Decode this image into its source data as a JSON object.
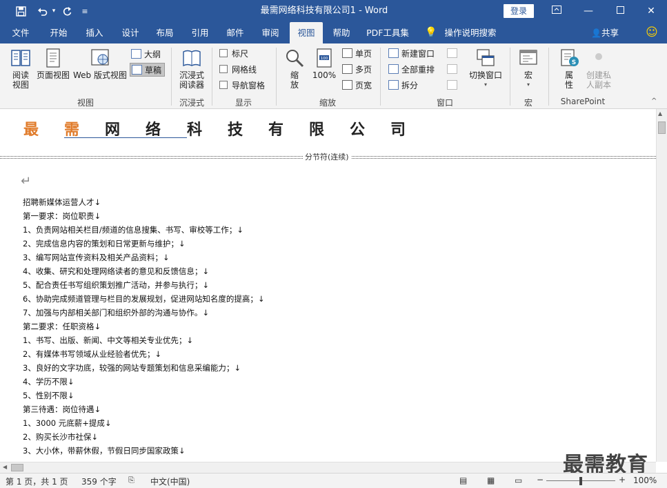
{
  "window": {
    "title": "最需网络科技有限公司1 - Word",
    "login": "登录"
  },
  "tabs": [
    "文件",
    "开始",
    "插入",
    "设计",
    "布局",
    "引用",
    "邮件",
    "审阅",
    "视图",
    "帮助",
    "PDF工具集",
    "操作说明搜索"
  ],
  "active_tab": "视图",
  "share": "共享",
  "ribbon": {
    "views": {
      "label": "视图",
      "read": "阅读\n视图",
      "print": "页面视图",
      "web": "Web 版式视图",
      "outline": "大纲",
      "draft": "草稿"
    },
    "immersive": {
      "label": "沉浸式",
      "reader": "沉浸式\n阅读器"
    },
    "show": {
      "label": "显示",
      "ruler": "标尺",
      "grid": "网格线",
      "nav": "导航窗格"
    },
    "zoom": {
      "label": "缩放",
      "zoom": "缩\n放",
      "hundred": "100%",
      "one": "单页",
      "multi": "多页",
      "width": "页宽"
    },
    "window": {
      "label": "窗口",
      "new": "新建窗口",
      "arrange": "全部重排",
      "split": "拆分",
      "switch": "切换窗口"
    },
    "macro": {
      "label": "宏",
      "macro": "宏"
    },
    "sharepoint": {
      "label": "SharePoint",
      "props": "属\n性",
      "copy": "创建私\n人副本"
    }
  },
  "doc": {
    "heading": [
      "最",
      "需",
      "网",
      "络",
      "科",
      "技",
      "有",
      "限",
      "公",
      "司"
    ],
    "section_break": "分节符(连续)",
    "lines": [
      "招聘新媒体运营人才↓",
      "第一要求：岗位职责↓",
      "1、负责网站相关栏目/频道的信息搜集、书写、审校等工作；↓",
      "2、完成信息内容的策划和日常更新与维护；↓",
      "3、编写网站宣传资料及相关产品资料；↓",
      "4、收集、研究和处理网络读者的意见和反馈信息；↓",
      "5、配合责任书写组织策划推广活动，并参与执行；↓",
      "6、协助完成频道管理与栏目的发展规划，促进网站知名度的提高；↓",
      "7、加强与内部相关部门和组织外部的沟通与协作。↓",
      "第二要求：任职资格↓",
      "1、书写、出版、新闻、中文等相关专业优先；↓",
      "2、有媒体书写领域从业经验者优先；↓",
      "3、良好的文字功底，较强的网站专题策划和信息采编能力；↓",
      "4、学历不限↓",
      "5、性别不限↓",
      "第三待遇：岗位待遇↓",
      "1、3000 元底薪+提成↓",
      "2、购买长沙市社保↓",
      "3、大小休，带薪休假，节假日同步国家政策↓"
    ]
  },
  "status": {
    "page": "第 1 页，共 1 页",
    "words": "359 个字",
    "lang": "中文(中国)",
    "zoom": "100%"
  },
  "watermark": "最需教育",
  "colors": {
    "brand": "#2b579a",
    "heading_accent": "#e07b2a"
  }
}
